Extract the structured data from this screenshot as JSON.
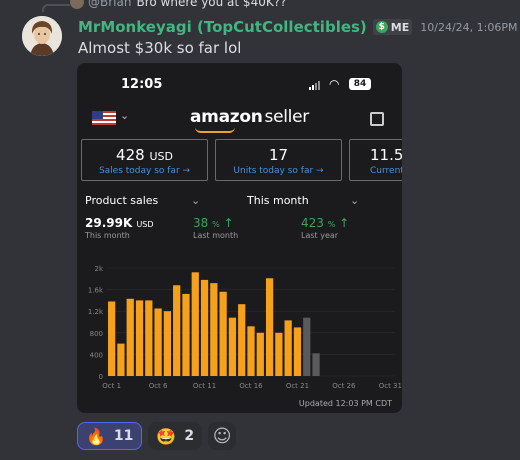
{
  "reply": {
    "username": "@Brian",
    "text": "Bro where you at $40K??"
  },
  "message": {
    "username": "MrMonkeyagi (TopCutCollectibles)",
    "tag": "ME",
    "tag_icon": "dollar-icon",
    "timestamp": "10/24/24, 1:06PM",
    "text": "Almost $30k so far lol"
  },
  "phone": {
    "time": "12:05",
    "battery": "84",
    "logo_main": "amazon",
    "logo_sub": "seller",
    "metrics": [
      {
        "value": "428",
        "unit": "USD",
        "label": "Sales today so far →"
      },
      {
        "value": "17",
        "unit": "",
        "label": "Units today so far →"
      },
      {
        "value": "11.53",
        "unit": "",
        "label": "Current B"
      }
    ],
    "dropdown_metric": "Product sales",
    "dropdown_period": "This month",
    "stats": [
      {
        "value": "29.99K",
        "unit": "USD",
        "arrow": "",
        "label": "This month",
        "color": "#ffffff"
      },
      {
        "value": "38",
        "unit": "%",
        "arrow": "↑",
        "label": "Last month",
        "color": "#3aa55d"
      },
      {
        "value": "423",
        "unit": "%",
        "arrow": "↑",
        "label": "Last year",
        "color": "#3aa55d"
      }
    ],
    "updated": "Updated 12:03 PM CDT"
  },
  "chart_data": {
    "type": "bar",
    "x": [
      "Oct 1",
      "Oct 2",
      "Oct 3",
      "Oct 4",
      "Oct 5",
      "Oct 6",
      "Oct 7",
      "Oct 8",
      "Oct 9",
      "Oct 10",
      "Oct 11",
      "Oct 12",
      "Oct 13",
      "Oct 14",
      "Oct 15",
      "Oct 16",
      "Oct 17",
      "Oct 18",
      "Oct 19",
      "Oct 20",
      "Oct 21",
      "Oct 22",
      "Oct 23"
    ],
    "values": [
      1380,
      600,
      1430,
      1400,
      1400,
      1250,
      1200,
      1680,
      1520,
      1920,
      1780,
      1720,
      1560,
      1080,
      1330,
      920,
      800,
      1810,
      800,
      1030,
      900,
      900,
      1380
    ],
    "comparison_values": [
      null,
      null,
      null,
      null,
      null,
      null,
      null,
      null,
      null,
      null,
      null,
      null,
      null,
      null,
      null,
      null,
      null,
      null,
      null,
      null,
      null,
      1080,
      420
    ],
    "xticks": [
      "Oct 1",
      "Oct 6",
      "Oct 11",
      "Oct 16",
      "Oct 21",
      "Oct 26",
      "Oct 31"
    ],
    "yticks": [
      "0",
      "400",
      "800",
      "1.2k",
      "1.6k",
      "2k"
    ],
    "ylim": [
      0,
      2000
    ],
    "days_in_month": 31,
    "bar_color": "#f5a11b",
    "comparison_color": "#5a5a5c"
  },
  "reactions": [
    {
      "emoji": "🔥",
      "count": "11",
      "active": true
    },
    {
      "emoji": "🤩",
      "count": "2",
      "active": false
    }
  ]
}
